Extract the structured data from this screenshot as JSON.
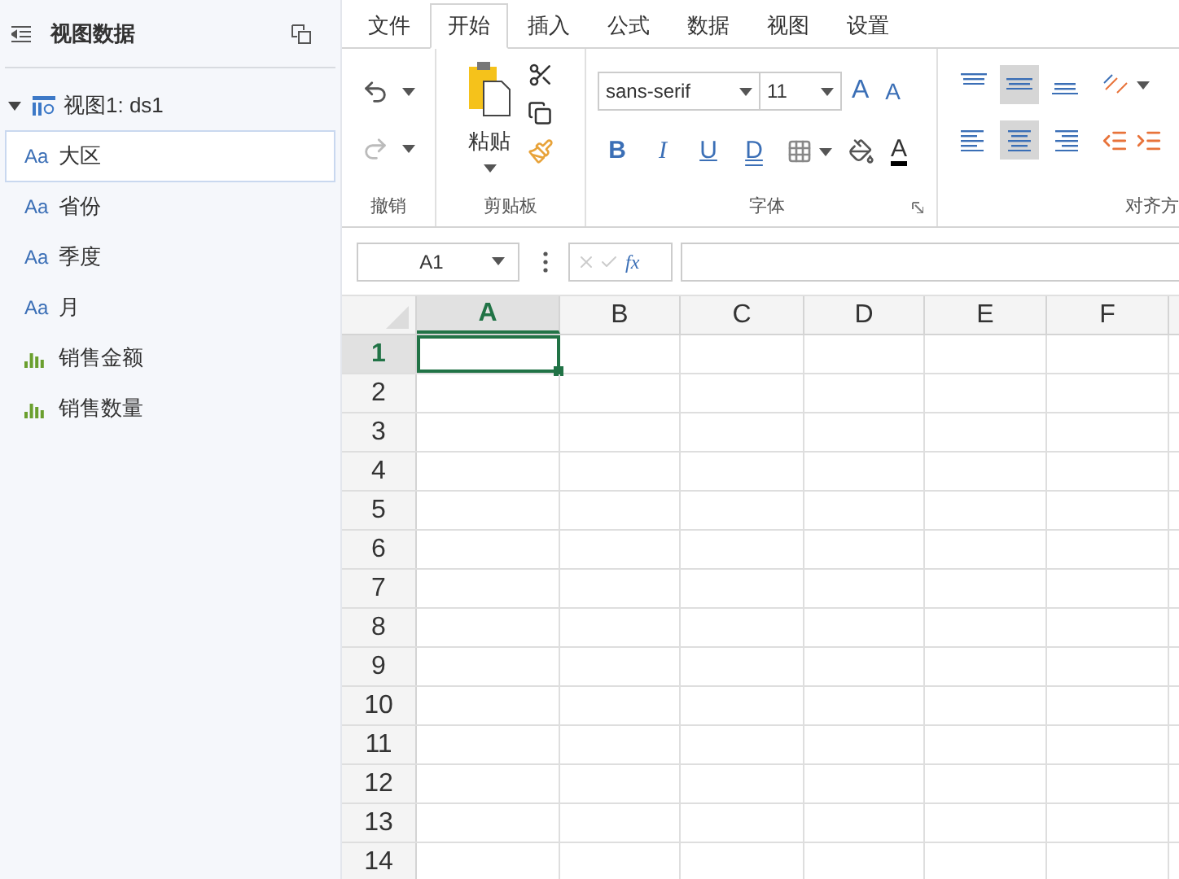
{
  "sidebar": {
    "title": "视图数据",
    "view": {
      "label": "视图1: ds1",
      "expanded": true
    },
    "items": [
      {
        "kind": "dimension",
        "glyph": "Aa",
        "label": "大区",
        "selected": true
      },
      {
        "kind": "dimension",
        "glyph": "Aa",
        "label": "省份",
        "selected": false
      },
      {
        "kind": "dimension",
        "glyph": "Aa",
        "label": "季度",
        "selected": false
      },
      {
        "kind": "dimension",
        "glyph": "Aa",
        "label": "月",
        "selected": false
      },
      {
        "kind": "measure",
        "label": "销售金额",
        "selected": false
      },
      {
        "kind": "measure",
        "label": "销售数量",
        "selected": false
      }
    ]
  },
  "tabs": [
    {
      "label": "文件",
      "selected": false
    },
    {
      "label": "开始",
      "selected": true
    },
    {
      "label": "插入",
      "selected": false
    },
    {
      "label": "公式",
      "selected": false
    },
    {
      "label": "数据",
      "selected": false
    },
    {
      "label": "视图",
      "selected": false
    },
    {
      "label": "设置",
      "selected": false
    }
  ],
  "ribbon": {
    "undo_group": "撤销",
    "clipboard_group": "剪贴板",
    "paste_label": "粘贴",
    "font_group": "字体",
    "font_name": "sans-serif",
    "font_size": "11",
    "grow_glyph": "A",
    "shrink_glyph": "A",
    "style_buttons": [
      "B",
      "I",
      "U",
      "D"
    ],
    "font_color_glyph": "A",
    "align_group": "对齐方",
    "vertical_align": [
      {
        "kind": "top",
        "selected": false
      },
      {
        "kind": "middle",
        "selected": true
      },
      {
        "kind": "bottom",
        "selected": false
      }
    ],
    "horizontal_align": [
      {
        "kind": "left",
        "selected": false
      },
      {
        "kind": "center",
        "selected": true
      },
      {
        "kind": "right",
        "selected": false
      }
    ]
  },
  "formula_bar": {
    "name_box": "A1",
    "fx": "fx"
  },
  "sheet": {
    "columns": [
      {
        "label": "A",
        "selected": true
      },
      {
        "label": "B",
        "selected": false
      },
      {
        "label": "C",
        "selected": false
      },
      {
        "label": "D",
        "selected": false
      },
      {
        "label": "E",
        "selected": false
      },
      {
        "label": "F",
        "selected": false
      }
    ],
    "rows": [
      {
        "label": "1",
        "selected": true
      },
      {
        "label": "2",
        "selected": false
      },
      {
        "label": "3",
        "selected": false
      },
      {
        "label": "4",
        "selected": false
      },
      {
        "label": "5",
        "selected": false
      },
      {
        "label": "6",
        "selected": false
      },
      {
        "label": "7",
        "selected": false
      },
      {
        "label": "8",
        "selected": false
      },
      {
        "label": "9",
        "selected": false
      },
      {
        "label": "10",
        "selected": false
      },
      {
        "label": "11",
        "selected": false
      },
      {
        "label": "12",
        "selected": false
      },
      {
        "label": "13",
        "selected": false
      },
      {
        "label": "14",
        "selected": false
      }
    ]
  }
}
